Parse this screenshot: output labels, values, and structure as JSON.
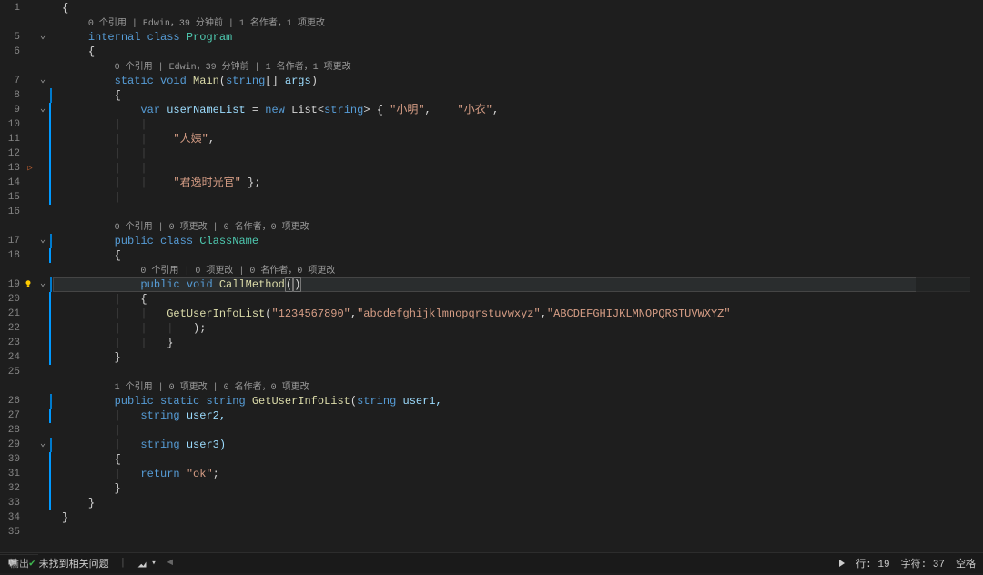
{
  "codelens": {
    "program": "0 个引用 | Edwin，39 分钟前 | 1 名作者，1 项更改",
    "main": "0 个引用 | Edwin，39 分钟前 | 1 名作者，1 项更改",
    "className": "0 个引用 | 0 项更改 | 0 名作者，0 项更改",
    "callMethod": "0 个引用 | 0 项更改 | 0 名作者，0 项更改",
    "getUserInfo": "1 个引用 | 0 项更改 | 0 名作者，0 项更改"
  },
  "code": {
    "l1": "{",
    "l5a": "internal",
    "l5b": " class ",
    "l5c": "Program",
    "l6": "{",
    "l7a": "static",
    "l7b": " void ",
    "l7c": "Main",
    "l7d": "(",
    "l7e": "string",
    "l7f": "[] ",
    "l7g": "args",
    "l7h": ")",
    "l8": "{",
    "l9a": "var",
    "l9b": " userNameList ",
    "l9c": "= ",
    "l9d": "new",
    "l9e": " List<",
    "l9f": "string",
    "l9g": "> { ",
    "l9h": "\"小明\"",
    "l9i": ",    ",
    "l9j": "\"小衣\"",
    "l9k": ",",
    "l11": "\"人姨\"",
    "l11b": ",",
    "l14": "\"君逸时光官\"",
    "l14b": " };",
    "l17a": "public",
    "l17b": " class ",
    "l17c": "ClassName",
    "l18": "{",
    "l19a": "public",
    "l19b": " void ",
    "l19c": "CallMethod",
    "l19d": "(",
    "l19e": ")",
    "l20": "{",
    "l21a": "GetUserInfoList",
    "l21b": "(",
    "l21c": "\"1234567890\"",
    "l21d": ",",
    "l21e": "\"abcdefghijklmnopqrstuvwxyz\"",
    "l21f": ",",
    "l21g": "\"ABCDEFGHIJKLMNOPQRSTUVWXYZ\"",
    "l22": ");",
    "l23": "}",
    "l24": "}",
    "l26a": "public",
    "l26b": " static ",
    "l26c": "string",
    "l26d": " GetUserInfoList",
    "l26e": "(",
    "l26f": "string",
    "l26g": " user1,",
    "l27a": "string",
    "l27b": " user2,",
    "l29a": "string",
    "l29b": " user3)",
    "l30": "{",
    "l31a": "return",
    "l31b": " \"ok\"",
    "l31c": ";",
    "l32": "}",
    "l33": "}",
    "l34": "}"
  },
  "lineNumbers": [
    "1",
    "",
    "5",
    "6",
    "",
    "7",
    "8",
    "9",
    "10",
    "11",
    "12",
    "13",
    "14",
    "15",
    "16",
    "",
    "17",
    "18",
    "",
    "19",
    "20",
    "21",
    "22",
    "23",
    "24",
    "25",
    "",
    "26",
    "27",
    "28",
    "29",
    "30",
    "31",
    "32",
    "33",
    "34",
    "35"
  ],
  "status": {
    "noIssues": "未找到相关问题",
    "line": "行: 19",
    "col": "字符: 37",
    "ins": "空格"
  },
  "output": {
    "label": "输出"
  }
}
